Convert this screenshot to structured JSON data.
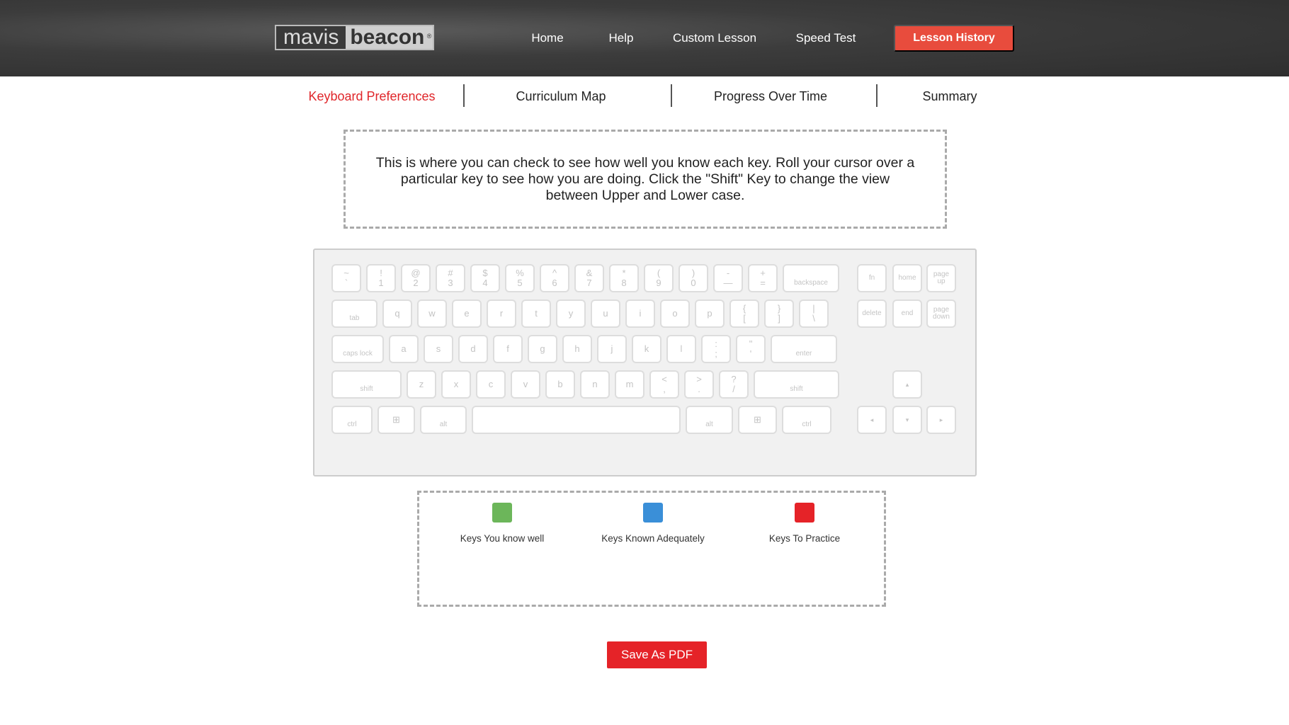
{
  "header": {
    "logo_left": "mavis",
    "logo_right": "beacon",
    "logo_mark": "®",
    "nav": [
      {
        "label": "Home"
      },
      {
        "label": "Help"
      },
      {
        "label": "Custom Lesson"
      },
      {
        "label": "Speed Test"
      }
    ],
    "lesson_history": "Lesson History"
  },
  "tabs": [
    {
      "label": "Keyboard Preferences",
      "active": true
    },
    {
      "label": "Curriculum Map"
    },
    {
      "label": "Progress Over Time"
    },
    {
      "label": "Summary"
    }
  ],
  "info_text": "This is where you can check to see how well you know each key. Roll your cursor over a particular key to see how you are doing. Click the \"Shift\" Key to change the view between Upper and Lower case.",
  "keyboard": {
    "rows": [
      [
        [
          "~",
          "`"
        ],
        [
          "!",
          "1"
        ],
        [
          "@",
          "2"
        ],
        [
          "#",
          "3"
        ],
        [
          "$",
          "4"
        ],
        [
          "%",
          "5"
        ],
        [
          "^",
          "6"
        ],
        [
          "&",
          "7"
        ],
        [
          "*",
          "8"
        ],
        [
          "(",
          "9"
        ],
        [
          ")",
          "0"
        ],
        [
          "-",
          "—"
        ],
        [
          "+",
          "="
        ],
        [
          "",
          "backspace"
        ]
      ],
      [
        [
          "",
          "tab"
        ],
        [
          "",
          "q"
        ],
        [
          "",
          "w"
        ],
        [
          "",
          "e"
        ],
        [
          "",
          "r"
        ],
        [
          "",
          "t"
        ],
        [
          "",
          "y"
        ],
        [
          "",
          "u"
        ],
        [
          "",
          "i"
        ],
        [
          "",
          "o"
        ],
        [
          "",
          "p"
        ],
        [
          "{",
          "["
        ],
        [
          "}",
          "]"
        ],
        [
          "|",
          "\\"
        ]
      ],
      [
        [
          "",
          "caps lock"
        ],
        [
          "",
          "a"
        ],
        [
          "",
          "s"
        ],
        [
          "",
          "d"
        ],
        [
          "",
          "f"
        ],
        [
          "",
          "g"
        ],
        [
          "",
          "h"
        ],
        [
          "",
          "j"
        ],
        [
          "",
          "k"
        ],
        [
          "",
          "l"
        ],
        [
          ":",
          ";"
        ],
        [
          "\"",
          "'"
        ],
        [
          "",
          "enter"
        ]
      ],
      [
        [
          "",
          "shift"
        ],
        [
          "",
          "z"
        ],
        [
          "",
          "x"
        ],
        [
          "",
          "c"
        ],
        [
          "",
          "v"
        ],
        [
          "",
          "b"
        ],
        [
          "",
          "n"
        ],
        [
          "",
          "m"
        ],
        [
          "<",
          ","
        ],
        [
          ">",
          "."
        ],
        [
          "?",
          "/"
        ],
        [
          "",
          "shift"
        ]
      ],
      [
        [
          "",
          "ctrl"
        ],
        [
          "",
          "⊞"
        ],
        [
          "",
          "alt"
        ],
        [
          "",
          ""
        ],
        [
          "",
          "alt"
        ],
        [
          "",
          "⊞"
        ],
        [
          "",
          "ctrl"
        ]
      ]
    ],
    "nav_keys": [
      [
        "fn"
      ],
      [
        "home"
      ],
      [
        "page",
        "up"
      ],
      [
        "delete"
      ],
      [
        "end"
      ],
      [
        "page",
        "down"
      ]
    ],
    "arrows": [
      "▴",
      "◂",
      "▾",
      "▸"
    ]
  },
  "legend": [
    {
      "label": "Keys You know well",
      "color": "#6cb65a"
    },
    {
      "label": "Keys Known Adequately",
      "color": "#3a8fd8"
    },
    {
      "label": "Keys To Practice",
      "color": "#e52328"
    }
  ],
  "save_pdf": "Save As PDF"
}
